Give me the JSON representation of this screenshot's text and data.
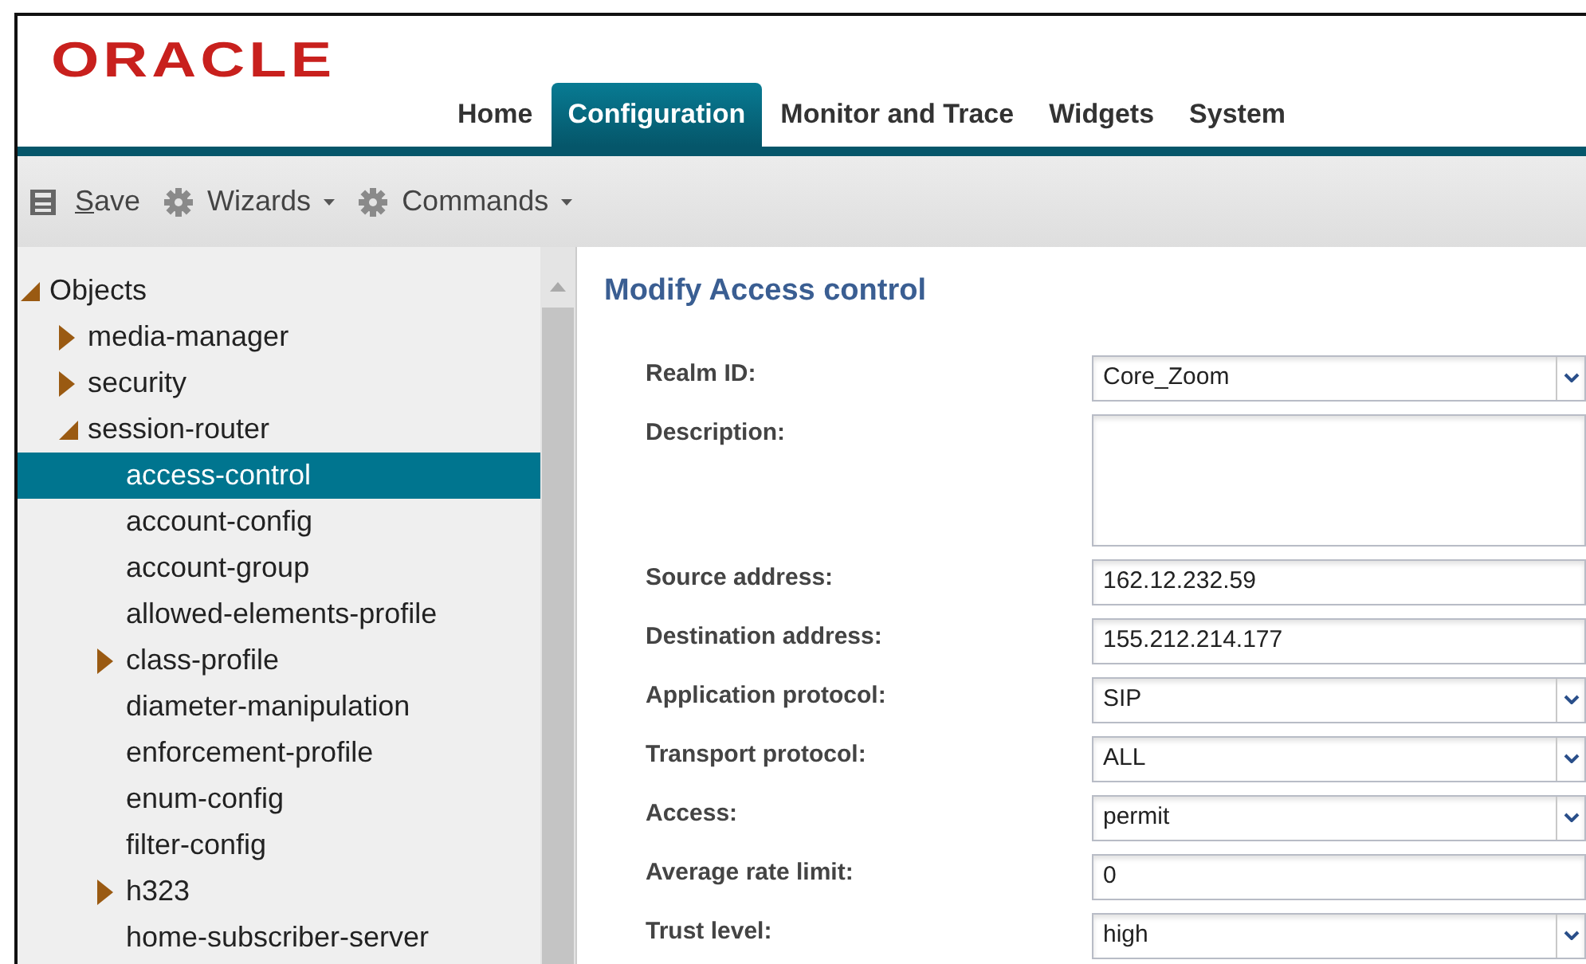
{
  "logo": "ORACLE",
  "tabs": [
    {
      "label": "Home",
      "selected": false
    },
    {
      "label": "Configuration",
      "selected": true
    },
    {
      "label": "Monitor and Trace",
      "selected": false
    },
    {
      "label": "Widgets",
      "selected": false
    },
    {
      "label": "System",
      "selected": false
    }
  ],
  "toolbar": [
    {
      "kind": "save",
      "label": "Save"
    },
    {
      "kind": "menu",
      "label": "Wizards"
    },
    {
      "kind": "menu",
      "label": "Commands"
    }
  ],
  "tree": [
    {
      "label": "Objects",
      "kind": "branch",
      "expanded": true,
      "selected": false,
      "children": [
        {
          "label": "media-manager",
          "kind": "branch",
          "expanded": false,
          "selected": false
        },
        {
          "label": "security",
          "kind": "branch",
          "expanded": false,
          "selected": false
        },
        {
          "label": "session-router",
          "kind": "branch",
          "expanded": true,
          "selected": false,
          "children": [
            {
              "label": "access-control",
              "kind": "leaf",
              "selected": true
            },
            {
              "label": "account-config",
              "kind": "leaf",
              "selected": false
            },
            {
              "label": "account-group",
              "kind": "leaf",
              "selected": false
            },
            {
              "label": "allowed-elements-profile",
              "kind": "leaf",
              "selected": false
            },
            {
              "label": "class-profile",
              "kind": "branch",
              "expanded": false,
              "selected": false
            },
            {
              "label": "diameter-manipulation",
              "kind": "leaf",
              "selected": false
            },
            {
              "label": "enforcement-profile",
              "kind": "leaf",
              "selected": false
            },
            {
              "label": "enum-config",
              "kind": "leaf",
              "selected": false
            },
            {
              "label": "filter-config",
              "kind": "leaf",
              "selected": false
            },
            {
              "label": "h323",
              "kind": "branch",
              "expanded": false,
              "selected": false
            },
            {
              "label": "home-subscriber-server",
              "kind": "leaf",
              "selected": false
            }
          ]
        }
      ]
    }
  ],
  "form": {
    "title": "Modify Access control",
    "fields": [
      {
        "label": "Realm ID:",
        "kind": "select",
        "value": "Core_Zoom"
      },
      {
        "label": "Description:",
        "kind": "textarea"
      },
      {
        "label": "Source address:",
        "kind": "text",
        "value": "162.12.232.59"
      },
      {
        "label": "Destination address:",
        "kind": "text",
        "value": "155.212.214.177"
      },
      {
        "label": "Application protocol:",
        "kind": "select",
        "value": "SIP"
      },
      {
        "label": "Transport protocol:",
        "kind": "select",
        "value": "ALL"
      },
      {
        "label": "Access:",
        "kind": "select",
        "value": "permit"
      },
      {
        "label": "Average rate limit:",
        "kind": "text",
        "value": "0"
      },
      {
        "label": "Trust level:",
        "kind": "select",
        "value": "high"
      }
    ]
  }
}
